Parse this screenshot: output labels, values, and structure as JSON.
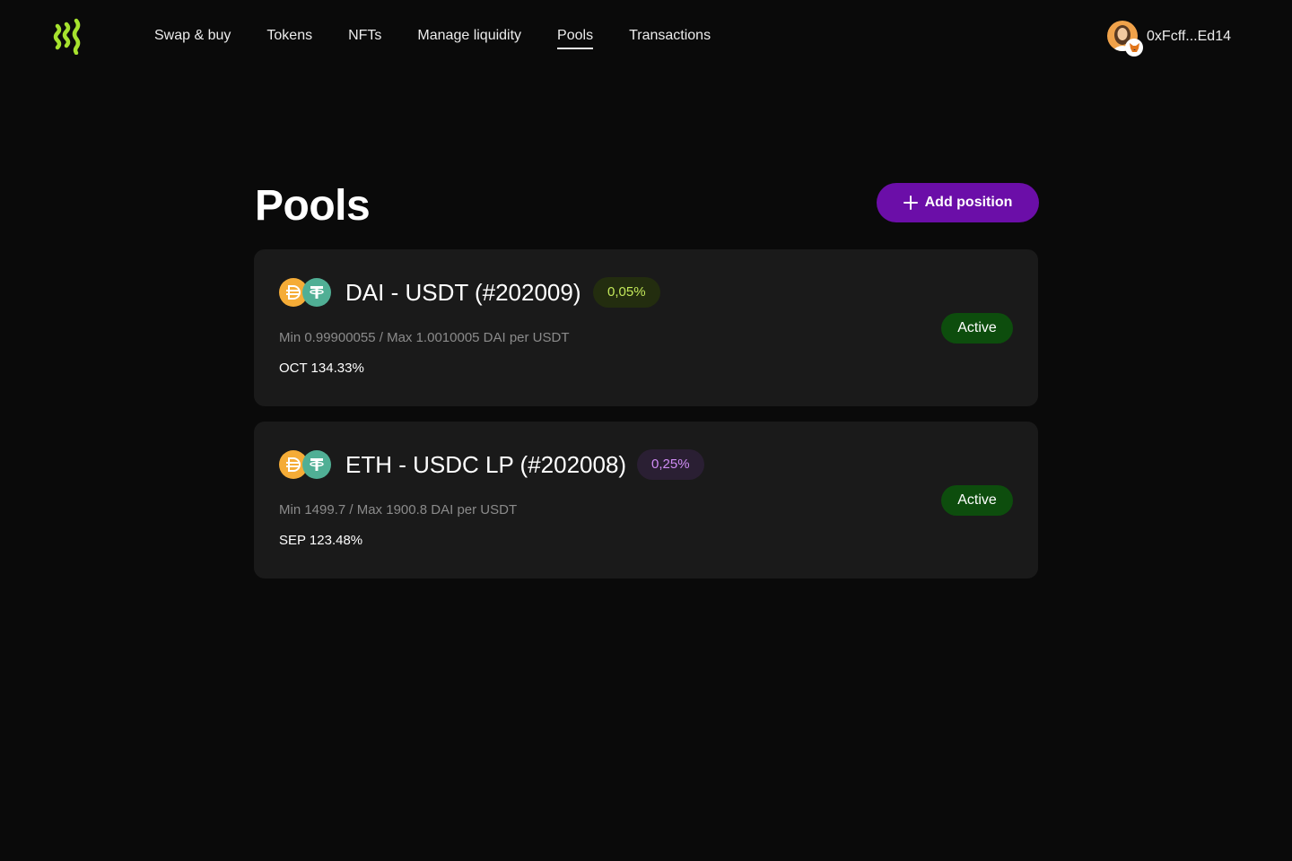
{
  "header": {
    "nav": [
      {
        "label": "Swap & buy"
      },
      {
        "label": "Tokens"
      },
      {
        "label": "NFTs"
      },
      {
        "label": "Manage liquidity"
      },
      {
        "label": "Pools",
        "active": true
      },
      {
        "label": "Transactions"
      }
    ],
    "account": {
      "address": "0xFcff...Ed14",
      "avatar_icon": "user-avatar",
      "wallet_icon": "metamask-fox-icon"
    },
    "logo_icon": "brand-logo-icon",
    "logo_color": "#a6e22e"
  },
  "main": {
    "title": "Pools",
    "add_position_label": "Add position",
    "accent_color": "#6b0ea8",
    "pools": [
      {
        "name": "DAI - USDT (#202009)",
        "fee": "0,05%",
        "range": "Min 0.99900055 / Max 1.0010005 DAI per USDT",
        "apr": "OCT 134.33%",
        "status": "Active",
        "token_icons": [
          "dai-icon",
          "usdt-icon"
        ]
      },
      {
        "name": "ETH - USDC LP (#202008)",
        "fee": "0,25%",
        "range": "Min 1499.7 / Max 1900.8 DAI per USDT",
        "apr": "SEP 123.48%",
        "status": "Active",
        "token_icons": [
          "dai-icon",
          "usdt-icon"
        ]
      }
    ]
  }
}
